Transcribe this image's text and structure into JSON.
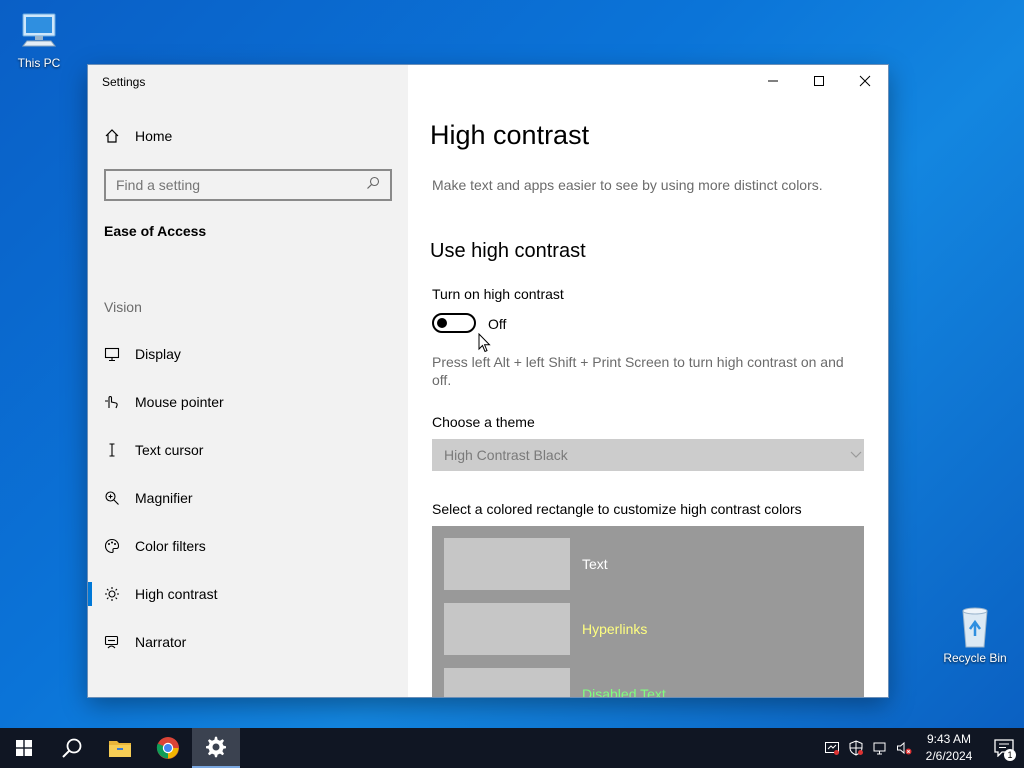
{
  "desktop": {
    "this_pc_label": "This PC",
    "recycle_bin_label": "Recycle Bin"
  },
  "window": {
    "title": "Settings",
    "controls": {
      "minimize": "—",
      "maximize": "☐",
      "close": "✕"
    }
  },
  "nav": {
    "home_label": "Home",
    "search_placeholder": "Find a setting",
    "section_title": "Ease of Access",
    "group_label": "Vision",
    "items": [
      {
        "label": "Display",
        "icon": "display-icon"
      },
      {
        "label": "Mouse pointer",
        "icon": "mouse-pointer-icon"
      },
      {
        "label": "Text cursor",
        "icon": "text-cursor-icon"
      },
      {
        "label": "Magnifier",
        "icon": "magnifier-icon"
      },
      {
        "label": "Color filters",
        "icon": "color-filters-icon"
      },
      {
        "label": "High contrast",
        "icon": "high-contrast-icon",
        "active": true
      },
      {
        "label": "Narrator",
        "icon": "narrator-icon"
      }
    ]
  },
  "main": {
    "title": "High contrast",
    "description": "Make text and apps easier to see by using more distinct colors.",
    "subtitle": "Use high contrast",
    "toggle_label": "Turn on high contrast",
    "toggle_state": "Off",
    "hint": "Press left Alt + left Shift + Print Screen to turn high contrast on and off.",
    "theme_label": "Choose a theme",
    "theme_value": "High Contrast Black",
    "colors_label": "Select a colored rectangle to customize high contrast colors",
    "swatches": [
      {
        "label": "Text",
        "color": "#ffffff"
      },
      {
        "label": "Hyperlinks",
        "color": "#ffff80"
      },
      {
        "label": "Disabled Text",
        "color": "#80ff80"
      }
    ]
  },
  "taskbar": {
    "clock_time": "9:43 AM",
    "clock_date": "2/6/2024",
    "notification_count": "1",
    "accent": "#0078d7"
  }
}
